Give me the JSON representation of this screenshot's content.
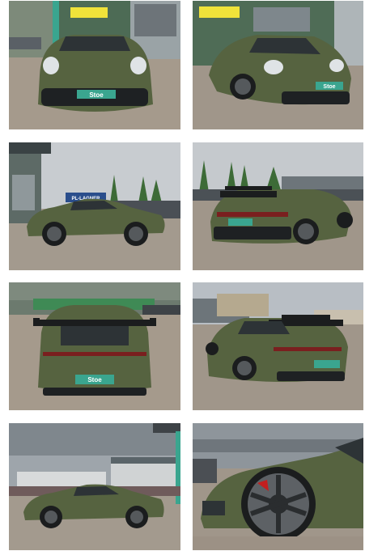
{
  "gallery": {
    "photos": [
      {
        "label": "Porsche 911 GT3 front view",
        "plate": "Stoe"
      },
      {
        "label": "Porsche 911 GT3 front three-quarter view",
        "plate": "Stoe"
      },
      {
        "label": "Porsche 911 GT3 side profile",
        "plate": ""
      },
      {
        "label": "Porsche 911 GT3 rear three-quarter view",
        "plate": ""
      },
      {
        "label": "Porsche 911 GT3 rear view",
        "plate": "Stoe"
      },
      {
        "label": "Porsche 911 GT3 rear three-quarter right view",
        "plate": ""
      },
      {
        "label": "Porsche 911 GT3 side view with dealership",
        "plate": ""
      },
      {
        "label": "Porsche 911 GT3 wheel detail",
        "plate": ""
      }
    ],
    "colors": {
      "car_green": "#566340",
      "car_green_dark": "#3b4529",
      "ground": "#9b8f82",
      "sky": "#c9ccd0",
      "plate_teal": "#3aa58f",
      "sign_yellow": "#f0e23a"
    }
  },
  "signage": {
    "dealer_sign": "PL-LAGNER"
  }
}
